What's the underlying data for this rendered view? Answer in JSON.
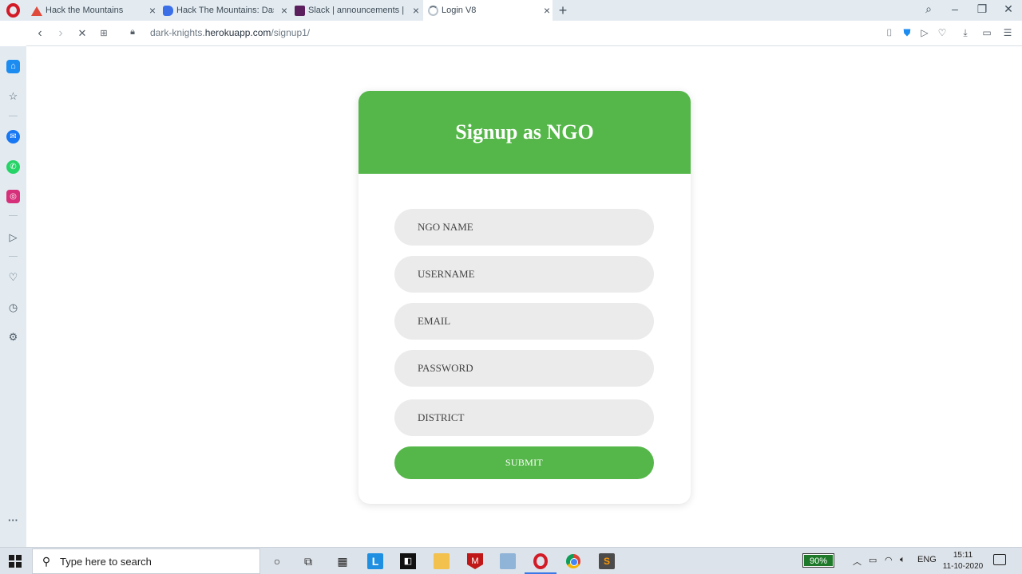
{
  "browser": {
    "tabs": [
      {
        "title": "Hack the Mountains",
        "active": false
      },
      {
        "title": "Hack The Mountains: Dash",
        "active": false
      },
      {
        "title": "Slack | announcements | Ha",
        "active": false
      },
      {
        "title": "Login V8",
        "active": true
      }
    ],
    "url_domain_prefix": "dark-knights.",
    "url_domain": "herokuapp.com",
    "url_path": "/signup1/"
  },
  "page": {
    "title": "Signup as NGO",
    "fields": {
      "ngo_name_placeholder": "NGO NAME",
      "username_placeholder": "USERNAME",
      "email_placeholder": "EMAIL",
      "password_placeholder": "PASSWORD",
      "district_placeholder": "DISTRICT"
    },
    "submit_label": "SUBMIT",
    "accent_color": "#55b749"
  },
  "taskbar": {
    "search_placeholder": "Type here to search",
    "battery": "90%",
    "language": "ENG",
    "time": "15:11",
    "date": "11-10-2020"
  }
}
